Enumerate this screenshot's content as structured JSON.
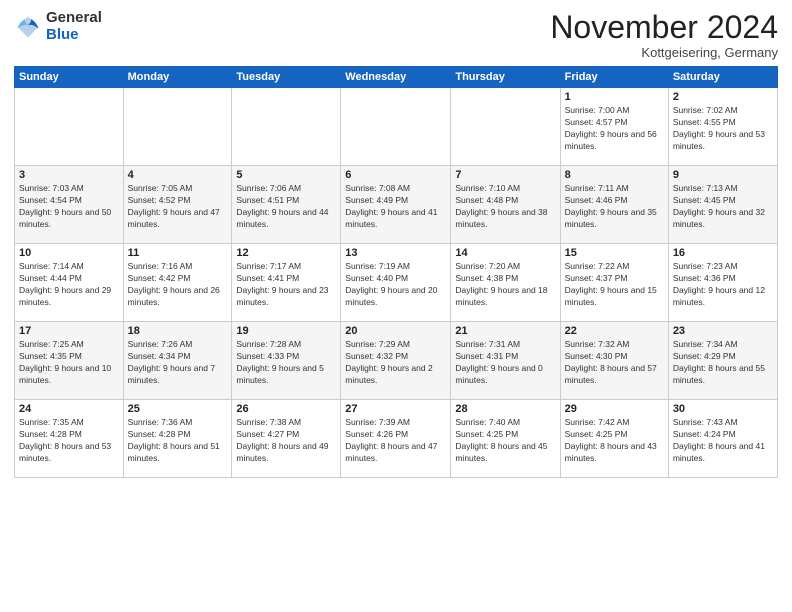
{
  "logo": {
    "line1": "General",
    "line2": "Blue"
  },
  "title": "November 2024",
  "location": "Kottgeisering, Germany",
  "days_of_week": [
    "Sunday",
    "Monday",
    "Tuesday",
    "Wednesday",
    "Thursday",
    "Friday",
    "Saturday"
  ],
  "weeks": [
    [
      {
        "day": "",
        "info": ""
      },
      {
        "day": "",
        "info": ""
      },
      {
        "day": "",
        "info": ""
      },
      {
        "day": "",
        "info": ""
      },
      {
        "day": "",
        "info": ""
      },
      {
        "day": "1",
        "info": "Sunrise: 7:00 AM\nSunset: 4:57 PM\nDaylight: 9 hours and 56 minutes."
      },
      {
        "day": "2",
        "info": "Sunrise: 7:02 AM\nSunset: 4:55 PM\nDaylight: 9 hours and 53 minutes."
      }
    ],
    [
      {
        "day": "3",
        "info": "Sunrise: 7:03 AM\nSunset: 4:54 PM\nDaylight: 9 hours and 50 minutes."
      },
      {
        "day": "4",
        "info": "Sunrise: 7:05 AM\nSunset: 4:52 PM\nDaylight: 9 hours and 47 minutes."
      },
      {
        "day": "5",
        "info": "Sunrise: 7:06 AM\nSunset: 4:51 PM\nDaylight: 9 hours and 44 minutes."
      },
      {
        "day": "6",
        "info": "Sunrise: 7:08 AM\nSunset: 4:49 PM\nDaylight: 9 hours and 41 minutes."
      },
      {
        "day": "7",
        "info": "Sunrise: 7:10 AM\nSunset: 4:48 PM\nDaylight: 9 hours and 38 minutes."
      },
      {
        "day": "8",
        "info": "Sunrise: 7:11 AM\nSunset: 4:46 PM\nDaylight: 9 hours and 35 minutes."
      },
      {
        "day": "9",
        "info": "Sunrise: 7:13 AM\nSunset: 4:45 PM\nDaylight: 9 hours and 32 minutes."
      }
    ],
    [
      {
        "day": "10",
        "info": "Sunrise: 7:14 AM\nSunset: 4:44 PM\nDaylight: 9 hours and 29 minutes."
      },
      {
        "day": "11",
        "info": "Sunrise: 7:16 AM\nSunset: 4:42 PM\nDaylight: 9 hours and 26 minutes."
      },
      {
        "day": "12",
        "info": "Sunrise: 7:17 AM\nSunset: 4:41 PM\nDaylight: 9 hours and 23 minutes."
      },
      {
        "day": "13",
        "info": "Sunrise: 7:19 AM\nSunset: 4:40 PM\nDaylight: 9 hours and 20 minutes."
      },
      {
        "day": "14",
        "info": "Sunrise: 7:20 AM\nSunset: 4:38 PM\nDaylight: 9 hours and 18 minutes."
      },
      {
        "day": "15",
        "info": "Sunrise: 7:22 AM\nSunset: 4:37 PM\nDaylight: 9 hours and 15 minutes."
      },
      {
        "day": "16",
        "info": "Sunrise: 7:23 AM\nSunset: 4:36 PM\nDaylight: 9 hours and 12 minutes."
      }
    ],
    [
      {
        "day": "17",
        "info": "Sunrise: 7:25 AM\nSunset: 4:35 PM\nDaylight: 9 hours and 10 minutes."
      },
      {
        "day": "18",
        "info": "Sunrise: 7:26 AM\nSunset: 4:34 PM\nDaylight: 9 hours and 7 minutes."
      },
      {
        "day": "19",
        "info": "Sunrise: 7:28 AM\nSunset: 4:33 PM\nDaylight: 9 hours and 5 minutes."
      },
      {
        "day": "20",
        "info": "Sunrise: 7:29 AM\nSunset: 4:32 PM\nDaylight: 9 hours and 2 minutes."
      },
      {
        "day": "21",
        "info": "Sunrise: 7:31 AM\nSunset: 4:31 PM\nDaylight: 9 hours and 0 minutes."
      },
      {
        "day": "22",
        "info": "Sunrise: 7:32 AM\nSunset: 4:30 PM\nDaylight: 8 hours and 57 minutes."
      },
      {
        "day": "23",
        "info": "Sunrise: 7:34 AM\nSunset: 4:29 PM\nDaylight: 8 hours and 55 minutes."
      }
    ],
    [
      {
        "day": "24",
        "info": "Sunrise: 7:35 AM\nSunset: 4:28 PM\nDaylight: 8 hours and 53 minutes."
      },
      {
        "day": "25",
        "info": "Sunrise: 7:36 AM\nSunset: 4:28 PM\nDaylight: 8 hours and 51 minutes."
      },
      {
        "day": "26",
        "info": "Sunrise: 7:38 AM\nSunset: 4:27 PM\nDaylight: 8 hours and 49 minutes."
      },
      {
        "day": "27",
        "info": "Sunrise: 7:39 AM\nSunset: 4:26 PM\nDaylight: 8 hours and 47 minutes."
      },
      {
        "day": "28",
        "info": "Sunrise: 7:40 AM\nSunset: 4:25 PM\nDaylight: 8 hours and 45 minutes."
      },
      {
        "day": "29",
        "info": "Sunrise: 7:42 AM\nSunset: 4:25 PM\nDaylight: 8 hours and 43 minutes."
      },
      {
        "day": "30",
        "info": "Sunrise: 7:43 AM\nSunset: 4:24 PM\nDaylight: 8 hours and 41 minutes."
      }
    ]
  ]
}
